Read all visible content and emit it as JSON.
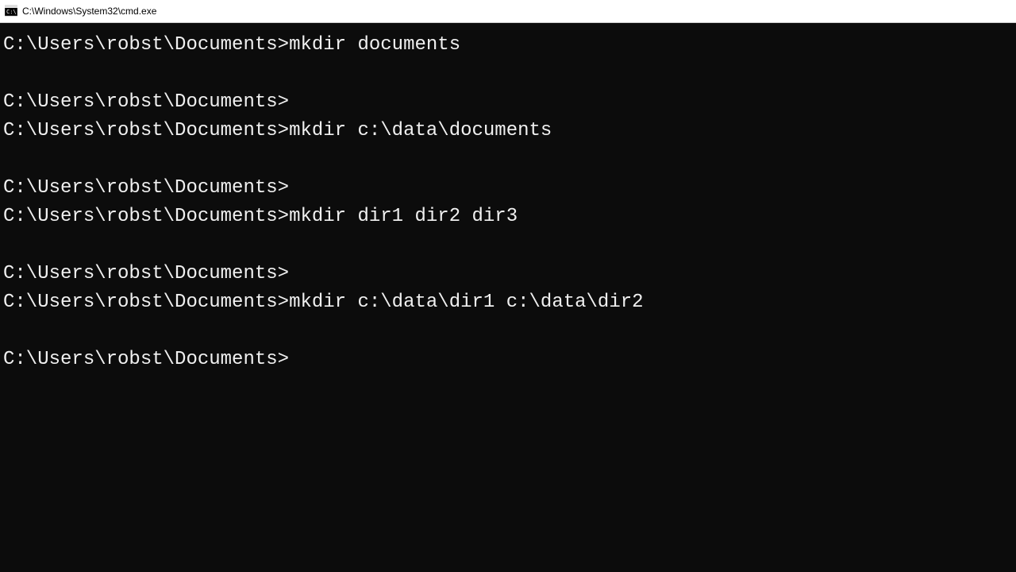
{
  "window": {
    "title": "C:\\Windows\\System32\\cmd.exe"
  },
  "terminal": {
    "prompt": "C:\\Users\\robst\\Documents>",
    "lines": [
      {
        "prompt": "C:\\Users\\robst\\Documents>",
        "command": "mkdir documents"
      },
      {
        "blank": true
      },
      {
        "prompt": "C:\\Users\\robst\\Documents>",
        "command": ""
      },
      {
        "prompt": "C:\\Users\\robst\\Documents>",
        "command": "mkdir c:\\data\\documents"
      },
      {
        "blank": true
      },
      {
        "prompt": "C:\\Users\\robst\\Documents>",
        "command": ""
      },
      {
        "prompt": "C:\\Users\\robst\\Documents>",
        "command": "mkdir dir1 dir2 dir3"
      },
      {
        "blank": true
      },
      {
        "prompt": "C:\\Users\\robst\\Documents>",
        "command": ""
      },
      {
        "prompt": "C:\\Users\\robst\\Documents>",
        "command": "mkdir c:\\data\\dir1 c:\\data\\dir2"
      },
      {
        "blank": true
      },
      {
        "prompt": "C:\\Users\\robst\\Documents>",
        "command": ""
      }
    ]
  }
}
